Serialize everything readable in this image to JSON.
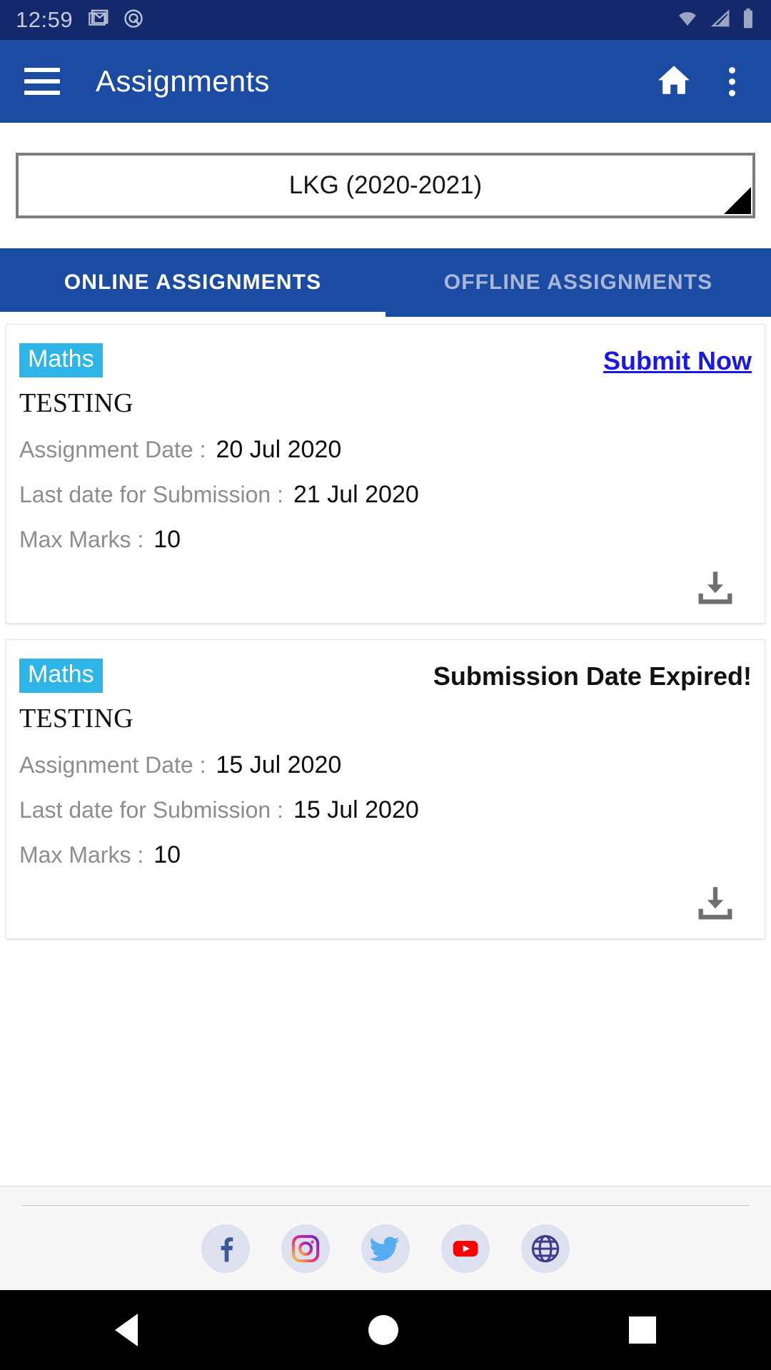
{
  "statusbar": {
    "time": "12:59",
    "icons_left": [
      "gmail-icon",
      "notification-circle-icon"
    ],
    "icons_right": [
      "wifi-icon",
      "signal-icon",
      "battery-icon"
    ]
  },
  "appbar": {
    "menu_icon": "hamburger-menu-icon",
    "title": "Assignments",
    "home_icon": "home-icon",
    "overflow_icon": "more-options-icon"
  },
  "spinner": {
    "selected": "LKG (2020-2021)",
    "arrow_icon": "dropdown-arrow-icon"
  },
  "tabs": [
    {
      "label": "ONLINE ASSIGNMENTS",
      "active": true
    },
    {
      "label": "OFFLINE ASSIGNMENTS",
      "active": false
    }
  ],
  "labels": {
    "assignment_date": "Assignment Date :",
    "last_date": "Last date for Submission :",
    "max_marks": "Max Marks :"
  },
  "cards": [
    {
      "subject": "Maths",
      "action_text": "Submit Now",
      "action_type": "link",
      "title": "TESTING",
      "assignment_date": "20 Jul 2020",
      "last_date": "21 Jul 2020",
      "max_marks": "10",
      "download_icon": "download-icon"
    },
    {
      "subject": "Maths",
      "action_text": "Submission Date Expired!",
      "action_type": "expired",
      "title": "TESTING",
      "assignment_date": "15 Jul 2020",
      "last_date": "15 Jul 2020",
      "max_marks": "10",
      "download_icon": "download-icon"
    }
  ],
  "footer": {
    "socials": [
      {
        "name": "facebook-icon",
        "color": "#3b5998"
      },
      {
        "name": "instagram-icon",
        "color": "#e1306c"
      },
      {
        "name": "twitter-icon",
        "color": "#55acee"
      },
      {
        "name": "youtube-icon",
        "color": "#ff0000"
      },
      {
        "name": "website-globe-icon",
        "color": "#3d3b8e"
      }
    ]
  },
  "navbar": {
    "back": "back-nav-icon",
    "home": "home-nav-icon",
    "recents": "recents-nav-icon"
  },
  "colors": {
    "primary": "#1b4ba3",
    "status_bar": "#13296b",
    "badge": "#2eb5e8",
    "link": "#1a18e8"
  }
}
